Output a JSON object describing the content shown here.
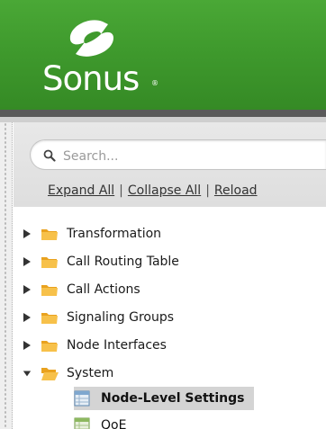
{
  "header": {
    "brand": "Sonus",
    "brand_mark": "®",
    "logo_icon": "sonus-swirl-logo",
    "colors": {
      "header_green": "#3f9a2d",
      "bar_dark": "#5a5a5a"
    }
  },
  "search": {
    "placeholder": "Search...",
    "icon": "search-icon"
  },
  "tree_actions": {
    "expand_all": "Expand All",
    "collapse_all": "Collapse All",
    "reload": "Reload",
    "separator": "|"
  },
  "tree": {
    "items": [
      {
        "label": "Transformation",
        "expanded": false,
        "icon": "folder-icon"
      },
      {
        "label": "Call Routing Table",
        "expanded": false,
        "icon": "folder-icon"
      },
      {
        "label": "Call Actions",
        "expanded": false,
        "icon": "folder-icon"
      },
      {
        "label": "Signaling Groups",
        "expanded": false,
        "icon": "folder-icon"
      },
      {
        "label": "Node Interfaces",
        "expanded": false,
        "icon": "folder-icon"
      },
      {
        "label": "System",
        "expanded": true,
        "icon": "folder-open-icon"
      }
    ],
    "children": [
      {
        "label": "Node-Level Settings",
        "selected": true,
        "icon": "table-icon"
      },
      {
        "label": "QoE",
        "selected": false,
        "icon": "table-icon"
      }
    ]
  }
}
